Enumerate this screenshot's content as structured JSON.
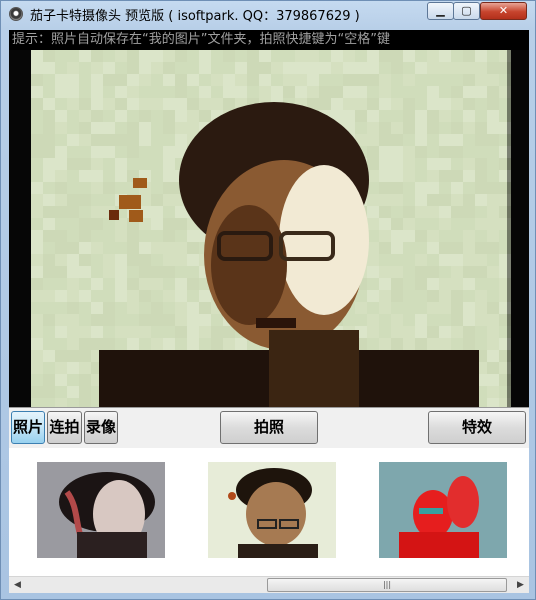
{
  "window": {
    "title": "茄子卡特摄像头 预览版 ( isoftpark. QQ：379867629 )",
    "minimize_glyph": "▁",
    "maximize_glyph": "▢",
    "close_glyph": "✕"
  },
  "hint_text": "提示：照片自动保存在“我的图片”文件夹，拍照快捷键为“空格”键",
  "toolbar": {
    "photo_label": "照片",
    "burst_label": "连拍",
    "record_label": "录像",
    "capture_label": "拍照",
    "effects_label": "特效",
    "active_tab": "照片"
  },
  "thumbnails": [
    {
      "name": "thumbnail-distorted"
    },
    {
      "name": "thumbnail-pinch"
    },
    {
      "name": "thumbnail-thermal"
    }
  ],
  "scrollbar": {
    "left_arrow": "◀",
    "right_arrow": "▶",
    "grip": "|||"
  },
  "colors": {
    "accent": "#98d1ef",
    "preview_tint": "#d6e2c0",
    "close_button": "#c7442d"
  }
}
